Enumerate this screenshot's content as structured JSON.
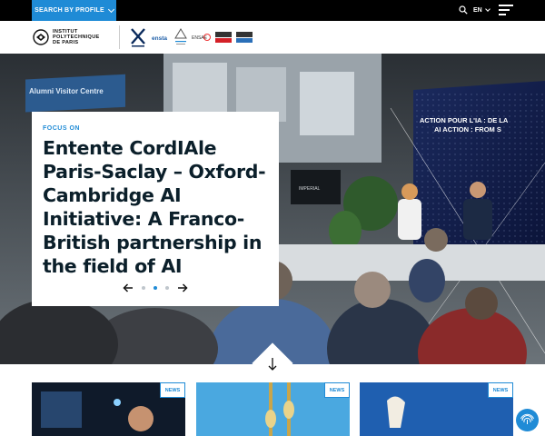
{
  "topbar": {
    "search_by_profile": "SEARCH BY PROFILE",
    "language": "EN"
  },
  "header": {
    "logo_line1": "INSTITUT",
    "logo_line2": "POLYTECHNIQUE",
    "logo_line3": "DE PARIS",
    "schools": [
      "ensta-logo",
      "ponts-logo",
      "ensae-logo",
      "telecom-paris-logo",
      "telecom-sudparis-logo"
    ]
  },
  "hero": {
    "kicker": "FOCUS ON",
    "title": "Entente CordIAle Paris-Saclay – Oxford-Cambridge AI Initiative: A Franco-British partnership in the field of AI",
    "screen_text": "ACTION POUR L'IA : DE LA AI ACTION : FROM S",
    "sign_text": "Alumni Visitor Centre",
    "slides_total": 3,
    "active_slide": 2
  },
  "news": [
    {
      "badge": "NEWS"
    },
    {
      "badge": "NEWS"
    },
    {
      "badge": "NEWS"
    }
  ],
  "colors": {
    "accent": "#1f8bd6",
    "title": "#0b1f2a",
    "topbar": "#000000"
  }
}
